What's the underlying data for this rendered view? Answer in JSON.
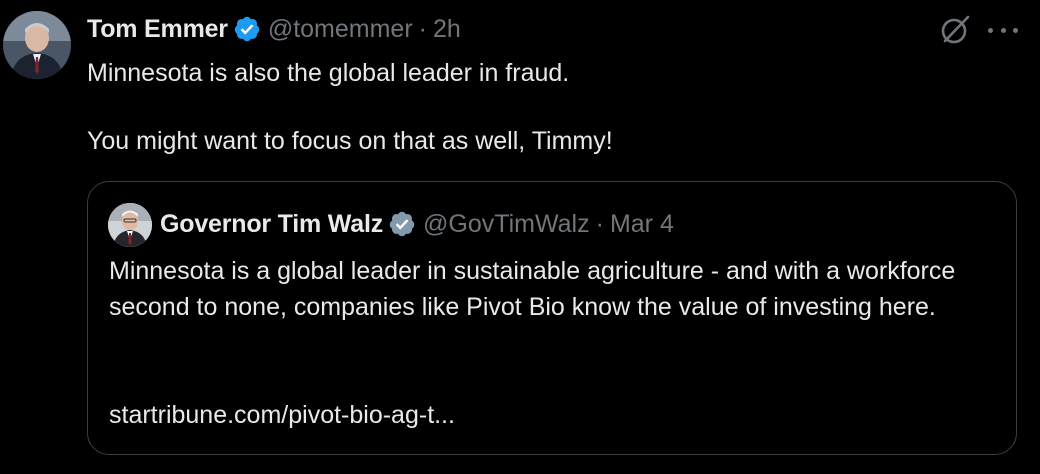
{
  "tweet": {
    "author_name": "Tom Emmer",
    "handle": "@tomemmer",
    "separator": "·",
    "time": "2h",
    "lines": [
      "Minnesota is also the global leader in fraud.",
      "You might want to focus on that as well, Timmy!"
    ],
    "icons": {
      "verified": "verified-badge-icon",
      "grok": "grok-icon",
      "more": "more-options-icon"
    }
  },
  "quote": {
    "author_name": "Governor Tim Walz",
    "handle": "@GovTimWalz",
    "separator": "·",
    "time": "Mar 4",
    "text": "Minnesota is a global leader in sustainable agriculture - and with a workforce second to none, companies like Pivot Bio know the value of investing here.",
    "link": "startribune.com/pivot-bio-ag-t..."
  },
  "colors": {
    "background": "#000000",
    "primary_text": "#e7e9ea",
    "secondary_text": "#71767b",
    "verified_blue": "#1d9bf0",
    "quote_border": "#3a3e42",
    "gov_badge_gray": "#829aab"
  }
}
